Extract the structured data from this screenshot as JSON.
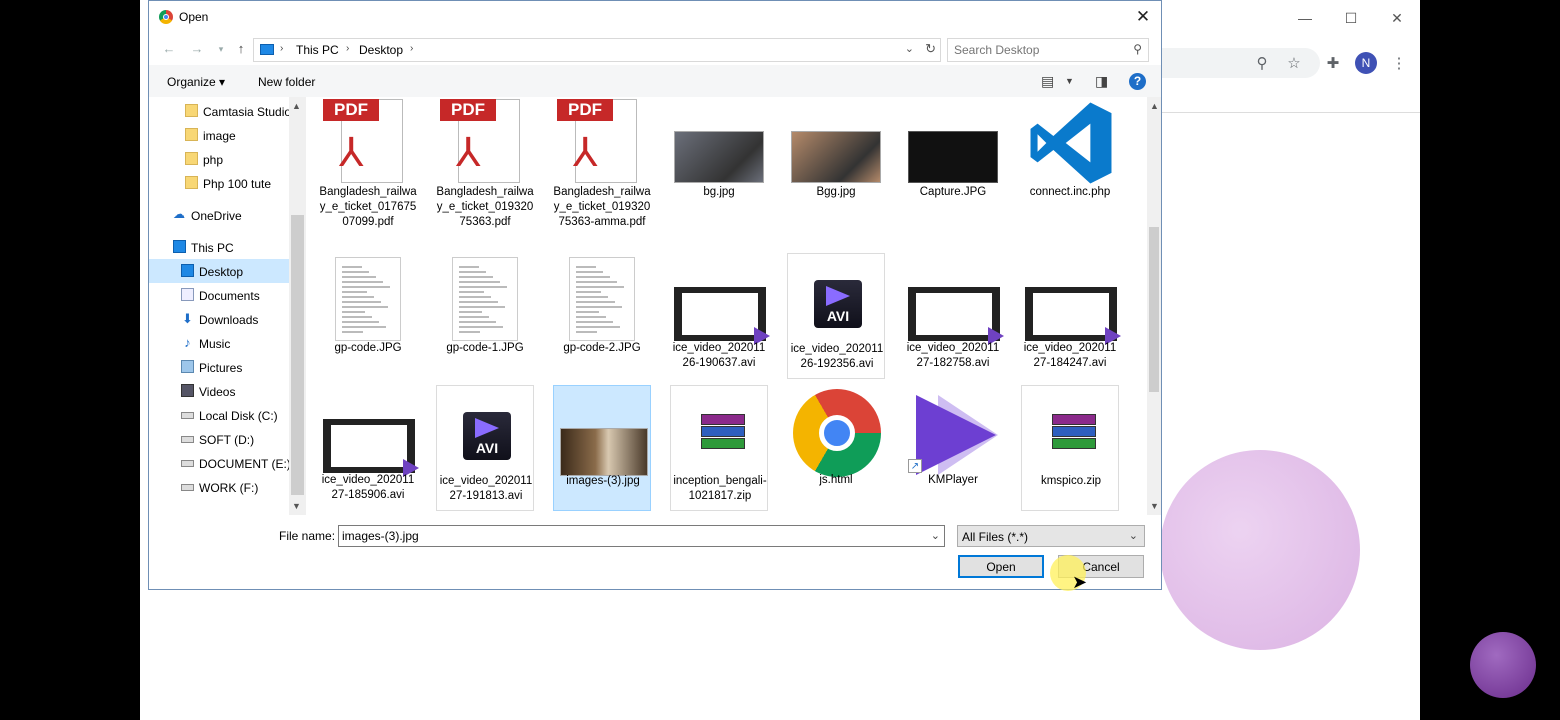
{
  "dialog": {
    "title": "Open",
    "close_glyph": "✕",
    "address": {
      "crumbs": [
        "This PC",
        "Desktop"
      ],
      "separator": "›"
    },
    "search_placeholder": "Search Desktop",
    "toolbar": {
      "organize": "Organize ▾",
      "new_folder": "New folder",
      "help": "?"
    },
    "nav": [
      {
        "label": "Camtasia Studio",
        "icon": "folder-icon"
      },
      {
        "label": "image",
        "icon": "folder-icon"
      },
      {
        "label": "php",
        "icon": "folder-icon"
      },
      {
        "label": "Php 100 tute",
        "icon": "folder-icon"
      },
      {
        "label": "OneDrive",
        "icon": "cloud-icon"
      },
      {
        "label": "This PC",
        "icon": "computer-icon"
      },
      {
        "label": "Desktop",
        "icon": "desktop-icon",
        "selected": true
      },
      {
        "label": "Documents",
        "icon": "documents-icon"
      },
      {
        "label": "Downloads",
        "icon": "download-icon"
      },
      {
        "label": "Music",
        "icon": "music-icon"
      },
      {
        "label": "Pictures",
        "icon": "pictures-icon"
      },
      {
        "label": "Videos",
        "icon": "videos-icon"
      },
      {
        "label": "Local Disk (C:)",
        "icon": "drive-icon"
      },
      {
        "label": "SOFT (D:)",
        "icon": "drive-icon"
      },
      {
        "label": "DOCUMENT (E:)",
        "icon": "drive-icon"
      },
      {
        "label": "WORK (F:)",
        "icon": "drive-icon"
      }
    ],
    "files": [
      {
        "name": "Bangladesh_railway_e_ticket_01767507099.pdf",
        "type": "pdf"
      },
      {
        "name": "Bangladesh_railway_e_ticket_01932075363.pdf",
        "type": "pdf"
      },
      {
        "name": "Bangladesh_railway_e_ticket_01932075363-amma.pdf",
        "type": "pdf"
      },
      {
        "name": "bg.jpg",
        "type": "photo",
        "color": "#6b6f7a"
      },
      {
        "name": "Bgg.jpg",
        "type": "photo",
        "color": "#b48a6a"
      },
      {
        "name": "Capture.JPG",
        "type": "screen"
      },
      {
        "name": "connect.inc.php",
        "type": "vscode"
      },
      {
        "name": "gp-code.JPG",
        "type": "doc"
      },
      {
        "name": "gp-code-1.JPG",
        "type": "doc"
      },
      {
        "name": "gp-code-2.JPG",
        "type": "doc"
      },
      {
        "name": "ice_video_20201126-190637.avi",
        "type": "film"
      },
      {
        "name": "ice_video_20201126-192356.avi",
        "type": "avi"
      },
      {
        "name": "ice_video_20201127-182758.avi",
        "type": "film"
      },
      {
        "name": "ice_video_20201127-184247.avi",
        "type": "film"
      },
      {
        "name": "ice_video_20201127-185906.avi",
        "type": "film"
      },
      {
        "name": "ice_video_20201127-191813.avi",
        "type": "avi"
      },
      {
        "name": "images-(3).jpg",
        "type": "photo",
        "color": "#7a5a3a",
        "selected": true
      },
      {
        "name": "inception_bengali-1021817.zip",
        "type": "rar"
      },
      {
        "name": "js.html",
        "type": "chrome"
      },
      {
        "name": "KMPlayer",
        "type": "kmp"
      },
      {
        "name": "kmspico.zip",
        "type": "rar"
      }
    ],
    "filename_label": "File name:",
    "filename_value": "images-(3).jpg",
    "filter_value": "All Files (*.*)",
    "open_label": "Open",
    "cancel_label": "Cancel",
    "pdf_badge": "PDF",
    "avi_badge": "AVI"
  },
  "browser": {
    "minimize": "—",
    "maximize": "☐",
    "close": "✕",
    "avatar_letter": "N"
  },
  "colors": {
    "selection": "#cce8ff",
    "accent": "#0078d7"
  }
}
